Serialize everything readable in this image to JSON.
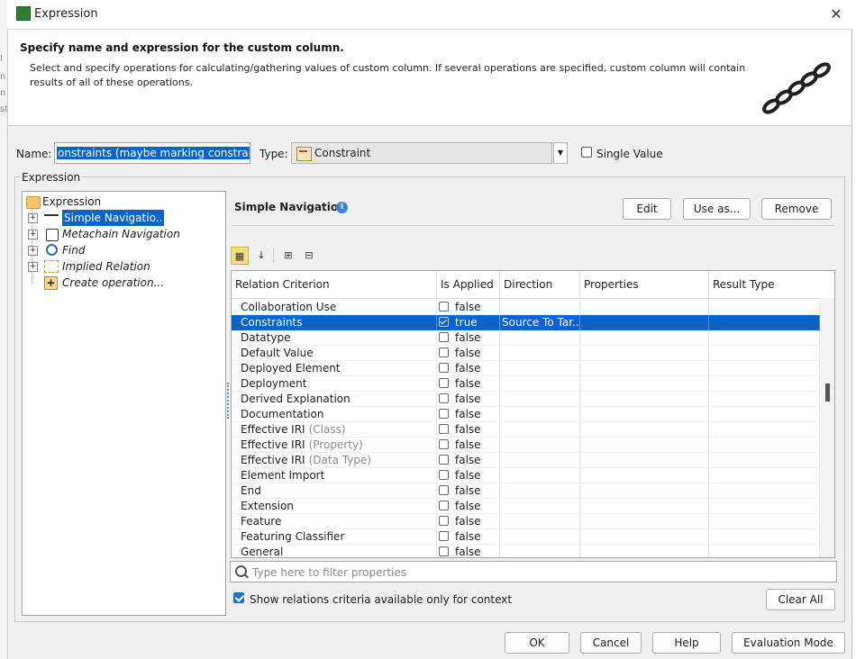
{
  "window": {
    "title": "Expression",
    "close_label": "✕"
  },
  "header": {
    "title": "Specify name and expression for the custom column.",
    "description": "Select and specify operations for calculating/gathering values of custom column. If several operations are specified, custom column will contain results of all of these operations."
  },
  "name_field": {
    "label": "Name:",
    "value": "onstraints (maybe marking constraint)"
  },
  "type_field": {
    "label": "Type:",
    "value": "Constraint",
    "dropdown_icon": "▼"
  },
  "single_value": {
    "label": "Single Value",
    "checked": false
  },
  "expression_group": {
    "label": "Expression"
  },
  "tree": {
    "root": "Expression",
    "items": [
      {
        "label": "Simple Navigatio..",
        "selected": true,
        "italic": false
      },
      {
        "label": "Metachain Navigation",
        "selected": false,
        "italic": true
      },
      {
        "label": "Find",
        "selected": false,
        "italic": true
      },
      {
        "label": "Implied Relation",
        "selected": false,
        "italic": true
      },
      {
        "label": "Create operation...",
        "selected": false,
        "italic": true
      }
    ]
  },
  "panel": {
    "title": "Simple Navigation",
    "info_icon": "i",
    "edit_label": "Edit",
    "use_as_label": "Use as...",
    "remove_label": "Remove"
  },
  "table": {
    "columns": [
      "Relation Criterion",
      "Is Applied",
      "Direction",
      "Properties",
      "Result Type"
    ],
    "rows": [
      {
        "name": "Collaboration Use",
        "suffix": "",
        "applied": false,
        "value": "false",
        "direction": ""
      },
      {
        "name": "Constraints",
        "suffix": "",
        "applied": true,
        "value": "true",
        "direction": "Source To Tar...",
        "selected": true
      },
      {
        "name": "Datatype",
        "suffix": "",
        "applied": false,
        "value": "false",
        "direction": ""
      },
      {
        "name": "Default Value",
        "suffix": "",
        "applied": false,
        "value": "false",
        "direction": ""
      },
      {
        "name": "Deployed Element",
        "suffix": "",
        "applied": false,
        "value": "false",
        "direction": ""
      },
      {
        "name": "Deployment",
        "suffix": "",
        "applied": false,
        "value": "false",
        "direction": ""
      },
      {
        "name": "Derived Explanation",
        "suffix": "",
        "applied": false,
        "value": "false",
        "direction": ""
      },
      {
        "name": "Documentation",
        "suffix": "",
        "applied": false,
        "value": "false",
        "direction": ""
      },
      {
        "name": "Effective IRI",
        "suffix": "(Class)",
        "applied": false,
        "value": "false",
        "direction": ""
      },
      {
        "name": "Effective IRI",
        "suffix": "(Property)",
        "applied": false,
        "value": "false",
        "direction": ""
      },
      {
        "name": "Effective IRI",
        "suffix": "(Data Type)",
        "applied": false,
        "value": "false",
        "direction": ""
      },
      {
        "name": "Element Import",
        "suffix": "",
        "applied": false,
        "value": "false",
        "direction": ""
      },
      {
        "name": "End",
        "suffix": "",
        "applied": false,
        "value": "false",
        "direction": ""
      },
      {
        "name": "Extension",
        "suffix": "",
        "applied": false,
        "value": "false",
        "direction": ""
      },
      {
        "name": "Feature",
        "suffix": "",
        "applied": false,
        "value": "false",
        "direction": ""
      },
      {
        "name": "Featuring Classifier",
        "suffix": "",
        "applied": false,
        "value": "false",
        "direction": ""
      },
      {
        "name": "General",
        "suffix": "",
        "applied": false,
        "value": "false",
        "direction": ""
      }
    ]
  },
  "filter": {
    "placeholder": "Type here to filter properties"
  },
  "show_context": {
    "label": "Show relations criteria available only for context",
    "checked": true
  },
  "clear_all_label": "Clear All",
  "footer": {
    "ok": "OK",
    "cancel": "Cancel",
    "help": "Help",
    "evaluation_mode": "Evaluation Mode"
  },
  "colors": {
    "selection": "#0a64c8",
    "dialog_bg": "#f0f0f0",
    "toolbar_active": "#f7dc8c"
  }
}
